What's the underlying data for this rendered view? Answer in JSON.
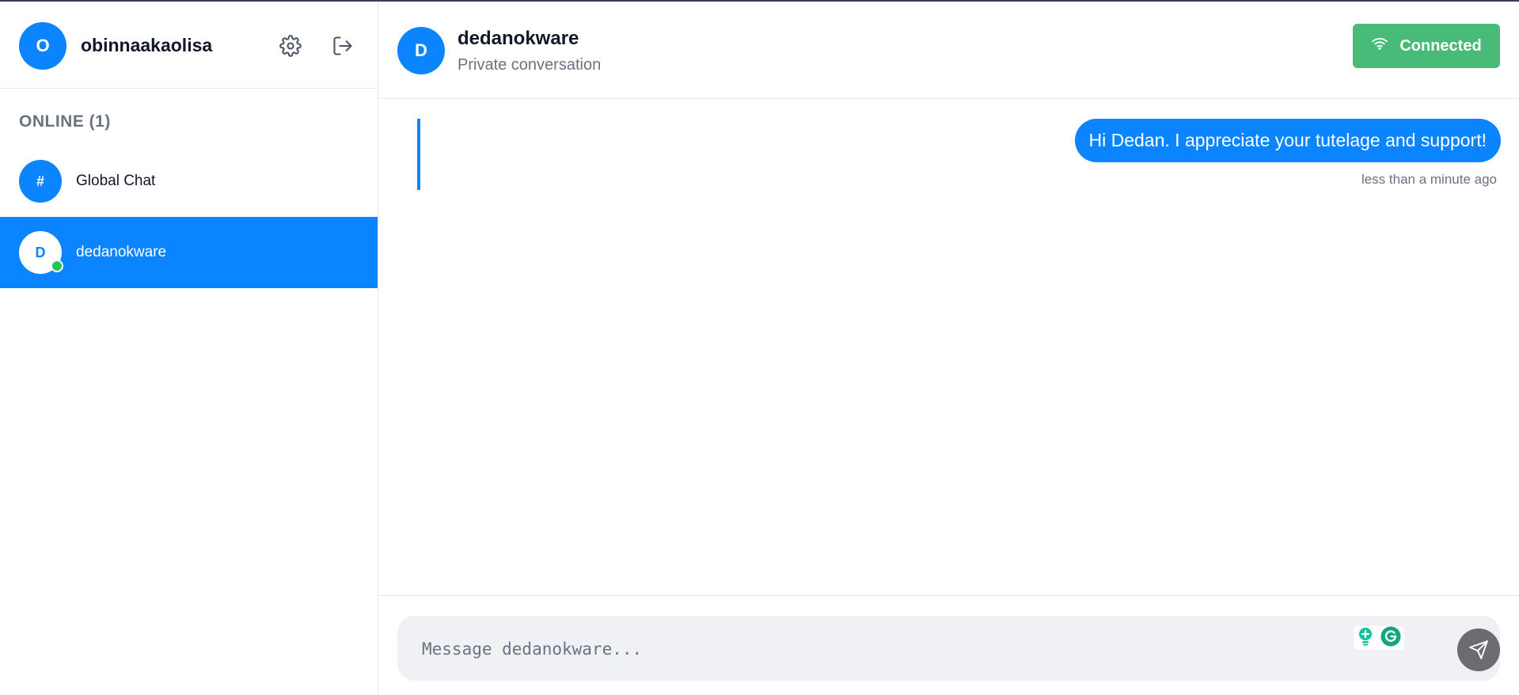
{
  "user": {
    "avatar_initial": "O",
    "name": "obinnaakaolisa"
  },
  "icons": {
    "settings": "gear-icon",
    "logout": "logout-icon",
    "wifi": "wifi-icon",
    "send": "send-icon"
  },
  "sidebar": {
    "online_header": "ONLINE (1)",
    "items": [
      {
        "avatar": "#",
        "label": "Global Chat",
        "active": false
      },
      {
        "avatar": "D",
        "label": "dedanokware",
        "active": true,
        "online": true
      }
    ]
  },
  "chat": {
    "avatar_initial": "D",
    "title": "dedanokware",
    "subtitle": "Private conversation",
    "connection_label": "Connected"
  },
  "messages": [
    {
      "text": "Hi Dedan. I appreciate your tutelage and support!",
      "time": "less than a minute ago",
      "own": true
    }
  ],
  "composer": {
    "placeholder": "Message dedanokware..."
  },
  "colors": {
    "accent": "#0a84ff",
    "connected": "#48bb78",
    "online": "#22c55e"
  }
}
